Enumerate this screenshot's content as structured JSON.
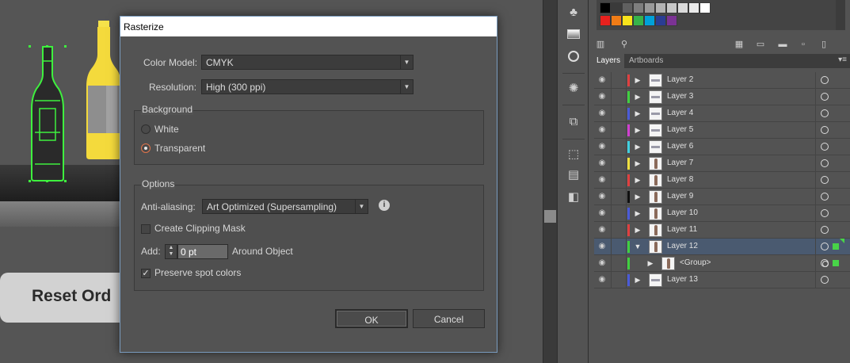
{
  "canvas": {
    "reset_label": "Reset Ord"
  },
  "dialog": {
    "title": "Rasterize",
    "color_model_label": "Color Model:",
    "color_model_value": "CMYK",
    "resolution_label": "Resolution:",
    "resolution_value": "High (300 ppi)",
    "background_title": "Background",
    "bg_white": "White",
    "bg_transparent": "Transparent",
    "bg_selected": "Transparent",
    "options_title": "Options",
    "anti_aliasing_label": "Anti-aliasing:",
    "anti_aliasing_value": "Art Optimized (Supersampling)",
    "clipping_mask_label": "Create Clipping Mask",
    "clipping_mask_checked": false,
    "add_label": "Add:",
    "add_value": "0 pt",
    "around_object_label": "Around Object",
    "preserve_spot_label": "Preserve spot colors",
    "preserve_spot_checked": true,
    "ok_label": "OK",
    "cancel_label": "Cancel"
  },
  "panel": {
    "tabs": [
      {
        "label": "Layers",
        "active": true
      },
      {
        "label": "Artboards",
        "active": false
      }
    ],
    "swatch_colors_row1": [
      "#000000",
      "#3a3a3a",
      "#606060",
      "#7e7e7e",
      "#9a9a9a",
      "#b4b4b4",
      "#c8c8c8",
      "#dadada",
      "#ebebeb",
      "#ffffff"
    ],
    "swatch_colors_row2": [
      "#e8211e",
      "#f07c16",
      "#f7e31b",
      "#37b34a",
      "#00a1d9",
      "#2a3d93",
      "#7b3294"
    ],
    "layers": [
      {
        "name": "Layer 2",
        "color": "#e04040",
        "thumb": "bar",
        "expanded": false,
        "selected": false
      },
      {
        "name": "Layer 3",
        "color": "#40d040",
        "thumb": "bar",
        "expanded": false,
        "selected": false
      },
      {
        "name": "Layer 4",
        "color": "#4a5ad8",
        "thumb": "bar",
        "expanded": false,
        "selected": false
      },
      {
        "name": "Layer 5",
        "color": "#d040d0",
        "thumb": "bar",
        "expanded": false,
        "selected": false
      },
      {
        "name": "Layer 6",
        "color": "#40d0e0",
        "thumb": "bar",
        "expanded": false,
        "selected": false
      },
      {
        "name": "Layer 7",
        "color": "#f0e040",
        "thumb": "bottle",
        "expanded": false,
        "selected": false
      },
      {
        "name": "Layer 8",
        "color": "#e04040",
        "thumb": "bottle",
        "expanded": false,
        "selected": false
      },
      {
        "name": "Layer 9",
        "color": "#101010",
        "thumb": "bottle",
        "expanded": false,
        "selected": false
      },
      {
        "name": "Layer 10",
        "color": "#4a5ad8",
        "thumb": "bottle",
        "expanded": false,
        "selected": false
      },
      {
        "name": "Layer 11",
        "color": "#e04040",
        "thumb": "bottle",
        "expanded": false,
        "selected": false
      },
      {
        "name": "Layer 12",
        "color": "#40d040",
        "thumb": "bottle",
        "expanded": true,
        "selected": true
      },
      {
        "name": "<Group>",
        "color": "#40d040",
        "thumb": "bottle",
        "expanded": false,
        "selected": false,
        "sublayer": true
      },
      {
        "name": "Layer 13",
        "color": "#4a5ad8",
        "thumb": "bar",
        "expanded": false,
        "selected": false
      }
    ]
  },
  "dock_icons": [
    "clubs-icon",
    "gradient-icon",
    "transparency-icon",
    "appearance-icon",
    "symbols-icon",
    "transform-icon",
    "align-icon",
    "pathfinder-icon"
  ]
}
